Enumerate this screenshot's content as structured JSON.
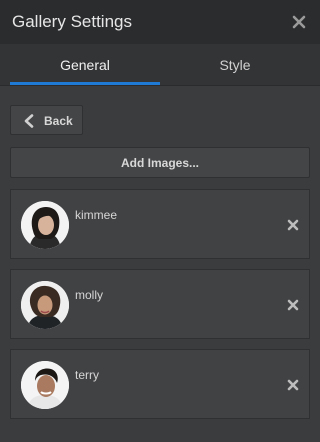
{
  "header": {
    "title": "Gallery Settings"
  },
  "tabs": [
    {
      "label": "General",
      "active": true
    },
    {
      "label": "Style",
      "active": false
    }
  ],
  "actions": {
    "back_label": "Back",
    "add_images_label": "Add Images..."
  },
  "images": [
    {
      "name": "kimmee"
    },
    {
      "name": "molly"
    },
    {
      "name": "terry"
    }
  ],
  "icons": {
    "close": "close-icon",
    "back": "chevron-left-icon",
    "remove": "remove-icon"
  },
  "colors": {
    "accent": "#1f7ad6",
    "panel_bg": "#3b3c3e",
    "header_bg": "#2b2c2e"
  }
}
